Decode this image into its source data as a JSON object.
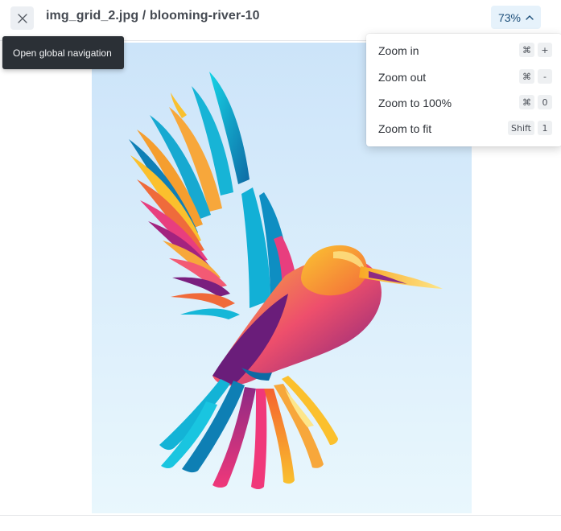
{
  "header": {
    "title": "img_grid_2.jpg / blooming-river-10",
    "close_icon": "close-icon",
    "zoom_label": "73%",
    "zoom_chevron_icon": "chevron-up-icon"
  },
  "tooltip": {
    "text": "Open global navigation"
  },
  "zoom_menu": {
    "items": [
      {
        "label": "Zoom in",
        "keys": [
          "⌘",
          "+"
        ]
      },
      {
        "label": "Zoom out",
        "keys": [
          "⌘",
          "-"
        ]
      },
      {
        "label": "Zoom to 100%",
        "keys": [
          "⌘",
          "0"
        ]
      },
      {
        "label": "Zoom to fit",
        "keys": [
          "Shift",
          "1"
        ]
      }
    ]
  },
  "image": {
    "subject": "colorful-hummingbird-illustration",
    "background_top": "#cfe6fa",
    "background_bottom": "#e8f6fd"
  },
  "colors": {
    "accent_bg": "#e6f2fb",
    "accent_text": "#1d4f7a",
    "tooltip_bg": "#2b3036"
  }
}
